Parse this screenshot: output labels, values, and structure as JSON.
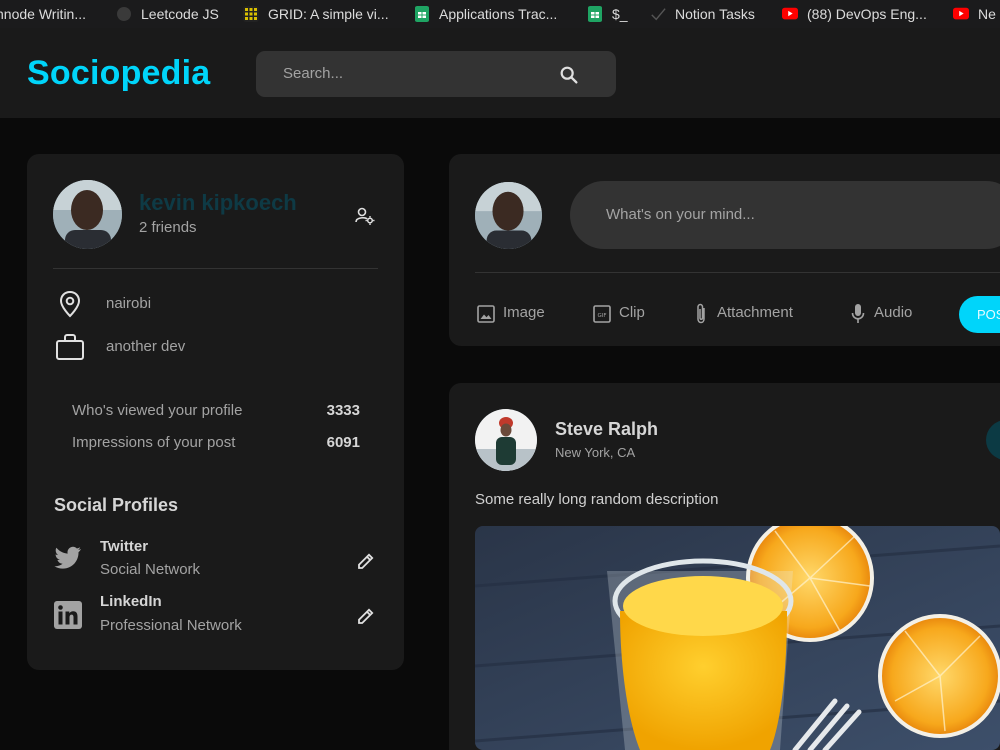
{
  "bookmarks": [
    {
      "label": "nnode Writin...",
      "icon": "page-icon",
      "color": "#1b1b1c"
    },
    {
      "label": "Leetcode JS",
      "icon": "github-icon",
      "color": "#3a3a3a"
    },
    {
      "label": "GRID: A simple vi...",
      "icon": "grid-icon",
      "color": "#d9c000"
    },
    {
      "label": "Applications Trac...",
      "icon": "sheets-icon",
      "color": "#1fa463"
    },
    {
      "label": "$_",
      "icon": "sheets-icon",
      "color": "#1fa463"
    },
    {
      "label": "Notion Tasks",
      "icon": "check-icon",
      "color": "#1b1b1c"
    },
    {
      "label": "(88) DevOps Eng...",
      "icon": "youtube-icon",
      "color": "#ff0000"
    },
    {
      "label": "Ne",
      "icon": "youtube-icon",
      "color": "#ff0000"
    }
  ],
  "navbar": {
    "logo": "Sociopedia",
    "search_placeholder": "Search...",
    "accent": "#00d5fa"
  },
  "user": {
    "name": "kevin kipkoech",
    "friends": "2 friends",
    "location": "nairobi",
    "occupation": "another dev",
    "stats": [
      {
        "label": "Who's viewed your profile",
        "value": "3333"
      },
      {
        "label": "Impressions of your post",
        "value": "6091"
      }
    ],
    "social_title": "Social Profiles",
    "socials": [
      {
        "name": "Twitter",
        "type": "Social Network"
      },
      {
        "name": "LinkedIn",
        "type": "Professional Network"
      }
    ]
  },
  "composer": {
    "placeholder": "What's on your mind...",
    "actions": [
      "Image",
      "Clip",
      "Attachment",
      "Audio"
    ],
    "post_button": "POST"
  },
  "post": {
    "author": "Steve Ralph",
    "location": "New York, CA",
    "description": "Some really long random description"
  }
}
